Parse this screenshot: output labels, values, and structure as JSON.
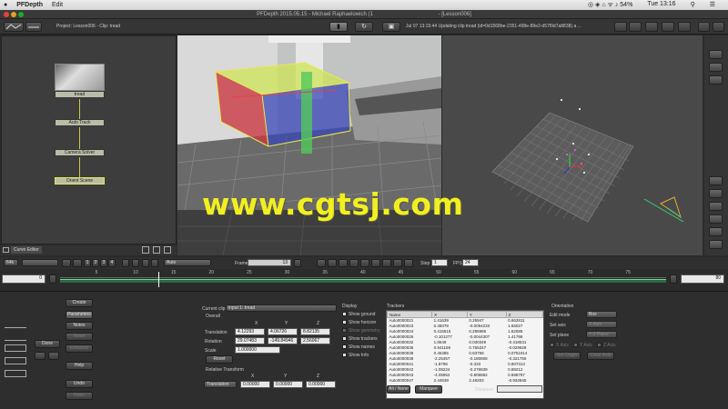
{
  "menubar": {
    "app": "PFDepth",
    "edit": "Edit",
    "status": "◎ ◈ ⌂ ᯤ ♪ 54%",
    "day_time": "Tue 13:16"
  },
  "window": {
    "title": "PFDepth 2015.05.15 - Michael Raphaelowich (1",
    "title2": "- [Lesson006]"
  },
  "toolbar": {
    "project": "Project: Lesson006 - Clip: tread",
    "status_line": "Jul 07 13:15:44 Updating clip tread (id=0d1568be-2351-498e-89e2-d57f9d7a8838) a ..."
  },
  "nodes": [
    "tread",
    "Auto Track",
    "Camera Solver",
    "Orient Scene"
  ],
  "curve_editor": "Curve Editor",
  "transport": {
    "format": "64k",
    "pages": [
      "1",
      "2",
      "3",
      "4"
    ],
    "mode": "Auto",
    "frame_label": "Frame",
    "frame": "13",
    "step_label": "Step",
    "step": "1",
    "fps_label": "FPS",
    "fps": "24"
  },
  "timeline": {
    "start": "0",
    "end": "80",
    "ticks": [
      "5",
      "10",
      "15",
      "20",
      "25",
      "30",
      "35",
      "40",
      "45",
      "50",
      "55",
      "60",
      "65",
      "70",
      "75"
    ],
    "playhead_frame": 13
  },
  "left_buttons": {
    "create": "Create",
    "parameters": "Parameters",
    "notes": "Notes",
    "rset": "Reset",
    "enhance": "Enhance",
    "help": "Help",
    "undo": "Undo",
    "redo": "Redo",
    "done": "Done"
  },
  "params": {
    "current_clip_label": "Current clip",
    "current_clip": "input 1: tread",
    "overall_label": "Overall",
    "cols": [
      "X",
      "Y",
      "Z"
    ],
    "translation_label": "Translation",
    "translation": [
      "4.12293",
      "4.06726",
      "8.82135"
    ],
    "rotation_label": "Rotation",
    "rotation": [
      "29.07483",
      "-149.84946",
      "2.56067"
    ],
    "scale_label": "Scale",
    "scale": "1.000000",
    "reset": "Reset",
    "relative_label": "Relative Transform",
    "relative_mode": "Translation",
    "relative": [
      "0.00000",
      "0.00000",
      "0.00000"
    ]
  },
  "display": {
    "title": "Display",
    "items": [
      {
        "label": "Show ground",
        "on": true
      },
      {
        "label": "Show horizon",
        "on": true
      },
      {
        "label": "Show geometry",
        "on": false
      },
      {
        "label": "Show trackers",
        "on": true
      },
      {
        "label": "Show names",
        "on": true
      },
      {
        "label": "Show Info",
        "on": true
      }
    ]
  },
  "trackers": {
    "title": "Trackers",
    "columns": [
      "Name",
      "X",
      "Y",
      "Z"
    ],
    "rows": [
      [
        "Auto0000021",
        "1.41639",
        "0.25947",
        "0.662811"
      ],
      [
        "Auto0000023",
        "0.46078",
        "-0.0094233",
        "1.65027"
      ],
      [
        "Auto0000024",
        "0.415515",
        "0.295985",
        "1.62085"
      ],
      [
        "Auto0000026",
        "-0.101277",
        "-0.0044307",
        "1.41798"
      ],
      [
        "Auto0000032",
        "1.8649",
        "0.030349",
        "-0.418531"
      ],
      [
        "Auto0000036",
        "0.941159",
        "0.755347",
        "-0.029928"
      ],
      [
        "Auto0000038",
        "0.45385",
        "0.83758",
        "0.0751914"
      ],
      [
        "Auto0000039",
        "-2.25357",
        "-0.180808",
        "-0.321759"
      ],
      [
        "Auto0000041",
        "-1.8796",
        "-0.333",
        "0.807313"
      ],
      [
        "Auto0000042",
        "-1.08224",
        "-0.276839",
        "0.88212"
      ],
      [
        "Auto0000043",
        "-4.05952",
        "-0.806582",
        "0.698787"
      ],
      [
        "Auto0000047",
        "2.44538",
        "2.48203",
        "-0.932845"
      ]
    ],
    "all_none": "All / None",
    "marquee": "Marquee",
    "distance_label": "Distance:"
  },
  "orientation": {
    "title": "Orientation",
    "edit_mode_label": "Edit mode",
    "edit_mode": "Box",
    "set_axis_label": "Set axis",
    "set_axis": "X Axis",
    "set_plane_label": "Set plane",
    "set_plane": "Y-Z Plane",
    "checks": [
      "X Axis",
      "Y Axis",
      "Z Axis"
    ],
    "set_origin": "Set Origin",
    "clear_axis": "Clear Axis"
  },
  "watermark": "www.cgtsj.com"
}
